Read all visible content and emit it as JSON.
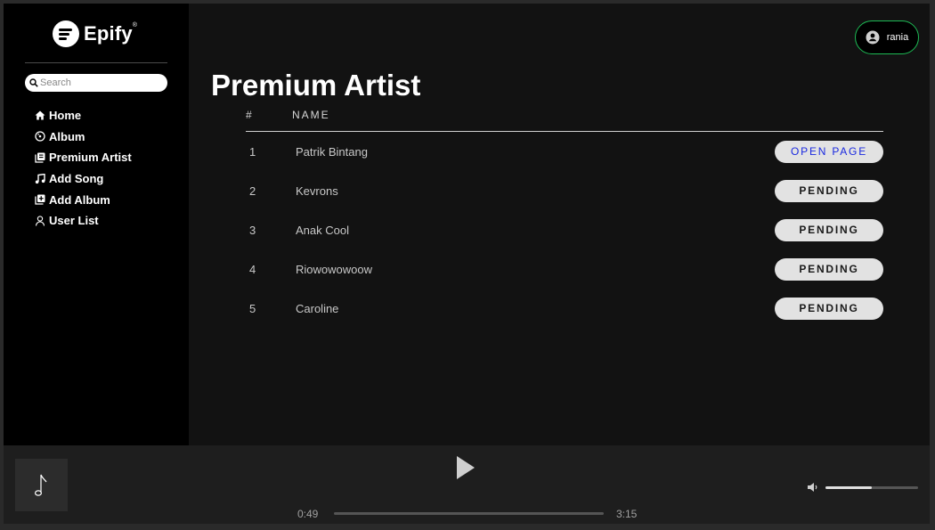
{
  "brand": {
    "name": "Epify"
  },
  "search": {
    "placeholder": "Search"
  },
  "sidebar": {
    "items": [
      {
        "label": "Home",
        "icon": "home-icon"
      },
      {
        "label": "Album",
        "icon": "album-icon"
      },
      {
        "label": "Premium Artist",
        "icon": "premium-artist-icon"
      },
      {
        "label": "Add Song",
        "icon": "music-note-icon"
      },
      {
        "label": "Add Album",
        "icon": "add-album-icon"
      },
      {
        "label": "User List",
        "icon": "user-icon"
      }
    ]
  },
  "user": {
    "name": "rania",
    "accent": "#1db954"
  },
  "page": {
    "title": "Premium Artist"
  },
  "table": {
    "headers": {
      "num": "#",
      "name": "NAME"
    },
    "rows": [
      {
        "num": "1",
        "name": "Patrik Bintang",
        "action": "OPEN PAGE"
      },
      {
        "num": "2",
        "name": "Kevrons",
        "action": "PENDING"
      },
      {
        "num": "3",
        "name": "Anak Cool",
        "action": "PENDING"
      },
      {
        "num": "4",
        "name": "Riowowowoow",
        "action": "PENDING"
      },
      {
        "num": "5",
        "name": "Caroline",
        "action": "PENDING"
      }
    ]
  },
  "player": {
    "current_time": "0:49",
    "total_time": "3:15",
    "progress": 0,
    "volume": 0.5
  }
}
